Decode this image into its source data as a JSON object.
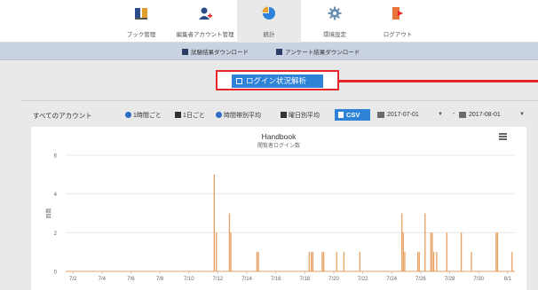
{
  "nav": {
    "items": [
      {
        "label": "ブック管理",
        "icon": "book-icon"
      },
      {
        "label": "編集者アカウント管理",
        "icon": "user-add-icon"
      },
      {
        "label": "統計",
        "icon": "pie-chart-icon",
        "active": true
      },
      {
        "label": "環境設定",
        "icon": "gear-icon"
      },
      {
        "label": "ログアウト",
        "icon": "logout-icon"
      }
    ]
  },
  "subnav": {
    "download_test_results": "試験結果ダウンロード",
    "download_survey_results": "アンケート結果ダウンロード"
  },
  "analysis_button": {
    "label": "ログイン状況解析"
  },
  "filters": {
    "account": "すべてのアカウント",
    "hourly": "1時間ごと",
    "daily": "1日ごと",
    "time_average": "時間帯別平均",
    "weekday_average": "曜日別平均",
    "csv": "CSV",
    "start_date": "2017-07-01",
    "date_separator": "-",
    "end_date": "2017-08-01"
  },
  "colors": {
    "accent": "#2e82d8",
    "highlight": "#e8262a",
    "series": "#e8a060"
  },
  "chart_data": {
    "type": "line",
    "title": "Handbook",
    "subtitle": "閲覧者ログイン数",
    "ylabel": "回数",
    "ylim": [
      0,
      6
    ],
    "yticks": [
      0,
      2,
      4,
      6
    ],
    "xlim": [
      1.5,
      32.5
    ],
    "x_tick_labels": [
      "7/2",
      "7/4",
      "7/6",
      "7/8",
      "7/10",
      "7/12",
      "7/14",
      "7/16",
      "7/18",
      "7/20",
      "7/22",
      "7/24",
      "7/26",
      "7/28",
      "7/30",
      "8/1"
    ],
    "x_tick_positions": [
      2,
      4,
      6,
      8,
      10,
      12,
      14,
      16,
      18,
      20,
      22,
      24,
      26,
      28,
      30,
      32
    ],
    "grid": true,
    "spikes": [
      {
        "x": 11.75,
        "y": 5.0
      },
      {
        "x": 11.9,
        "y": 2.0
      },
      {
        "x": 12.8,
        "y": 3.0
      },
      {
        "x": 12.9,
        "y": 2.0
      },
      {
        "x": 14.7,
        "y": 1.0
      },
      {
        "x": 14.8,
        "y": 1.0
      },
      {
        "x": 18.3,
        "y": 1.0
      },
      {
        "x": 18.45,
        "y": 1.0
      },
      {
        "x": 18.55,
        "y": 1.0
      },
      {
        "x": 19.2,
        "y": 1.0
      },
      {
        "x": 19.3,
        "y": 1.0
      },
      {
        "x": 20.2,
        "y": 1.0
      },
      {
        "x": 20.7,
        "y": 1.0
      },
      {
        "x": 21.8,
        "y": 1.0
      },
      {
        "x": 24.7,
        "y": 3.0
      },
      {
        "x": 24.8,
        "y": 2.0
      },
      {
        "x": 24.9,
        "y": 1.0
      },
      {
        "x": 25.8,
        "y": 1.0
      },
      {
        "x": 25.9,
        "y": 1.0
      },
      {
        "x": 26.3,
        "y": 3.0
      },
      {
        "x": 26.7,
        "y": 2.0
      },
      {
        "x": 26.8,
        "y": 2.0
      },
      {
        "x": 26.9,
        "y": 1.0
      },
      {
        "x": 27.1,
        "y": 1.0
      },
      {
        "x": 27.8,
        "y": 2.0
      },
      {
        "x": 28.8,
        "y": 2.0
      },
      {
        "x": 29.5,
        "y": 1.0
      },
      {
        "x": 31.2,
        "y": 2.0
      },
      {
        "x": 31.3,
        "y": 2.0
      },
      {
        "x": 32.3,
        "y": 1.0
      }
    ]
  }
}
